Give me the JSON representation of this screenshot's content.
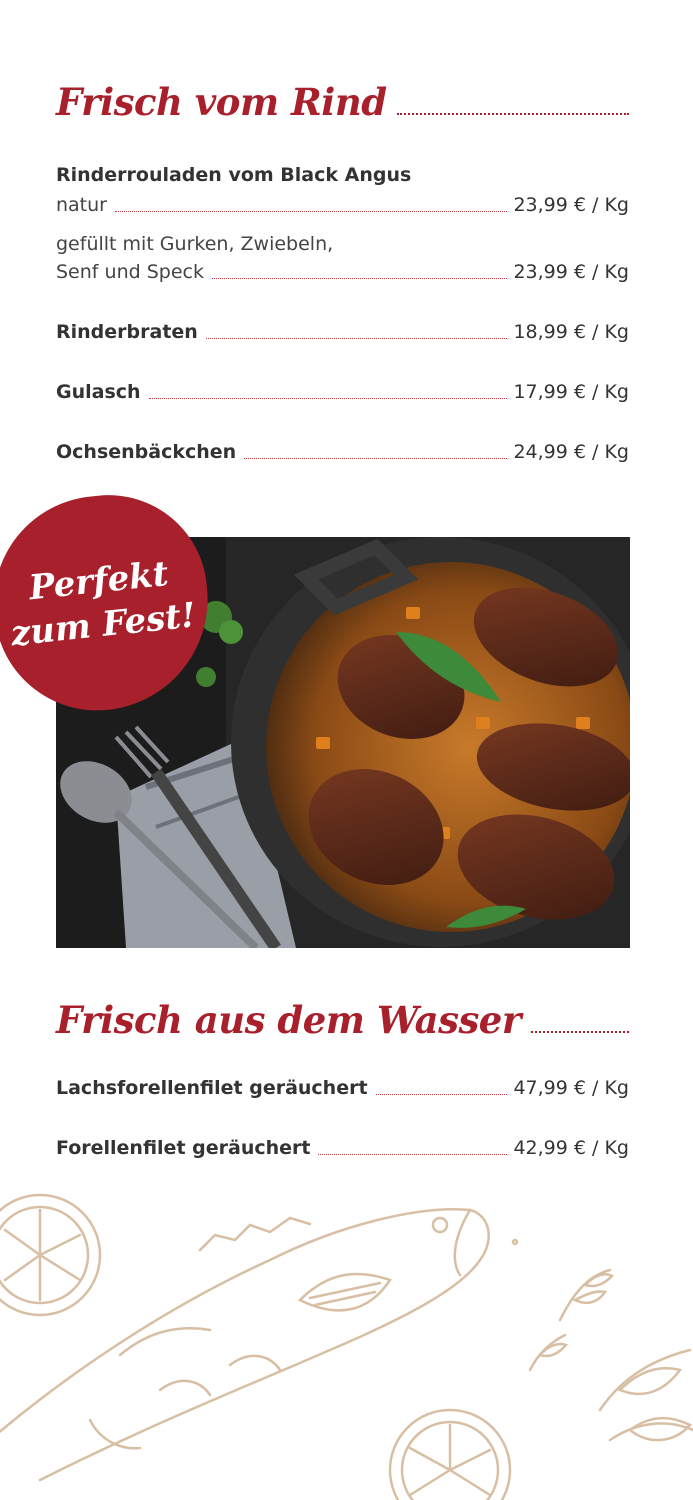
{
  "section_rind": {
    "title": "Frisch vom Rind",
    "rouladen_heading": "Rinderrouladen vom Black Angus",
    "items": [
      {
        "name": "natur",
        "price": "23,99 € / Kg"
      },
      {
        "name_line1": "gefüllt mit Gurken, Zwiebeln,",
        "name": "Senf und Speck",
        "price": "23,99 € / Kg"
      },
      {
        "name": "Rinderbraten",
        "price": "18,99 € / Kg"
      },
      {
        "name": "Gulasch",
        "price": "17,99 € / Kg"
      },
      {
        "name": "Ochsenbäckchen",
        "price": "24,99 € / Kg"
      }
    ]
  },
  "badge": {
    "line1": "Perfekt",
    "line2": "zum Fest!"
  },
  "section_wasser": {
    "title": "Frisch aus dem Wasser",
    "items": [
      {
        "name": "Lachsforellenfilet geräuchert",
        "price": "47,99 € / Kg"
      },
      {
        "name": "Forellenfilet geräuchert",
        "price": "42,99 € / Kg"
      }
    ]
  },
  "colors": {
    "accent_red": "#a8202c",
    "illustration_beige": "#d8bfa4"
  }
}
